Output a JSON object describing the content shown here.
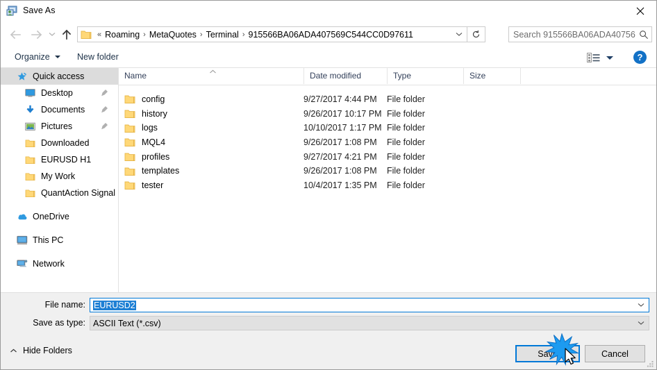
{
  "window": {
    "title": "Save As",
    "close_label": "✕",
    "icon": "save-as-app-icon"
  },
  "nav": {
    "back_icon": "back-arrow-icon",
    "forward_icon": "forward-arrow-icon",
    "recent_icon": "chevron-down-icon",
    "up_icon": "up-arrow-icon"
  },
  "address": {
    "folder_icon": "folder-icon",
    "overflow_marker": "«",
    "crumbs": [
      "Roaming",
      "MetaQuotes",
      "Terminal",
      "915566BA06ADA407569C544CC0D97611"
    ],
    "separator": "›",
    "dropdown_icon": "chevron-down-icon",
    "refresh_icon": "refresh-icon"
  },
  "search": {
    "placeholder": "Search 915566BA06ADA40756...",
    "icon": "search-icon"
  },
  "toolbar": {
    "organize_label": "Organize",
    "new_folder_label": "New folder",
    "view_icon": "view-layout-icon",
    "view_caret_icon": "chevron-down-icon",
    "help_label": "?"
  },
  "sidebar": {
    "items": [
      {
        "label": "Quick access",
        "icon": "star-pin-icon",
        "level": 1,
        "selected": true,
        "pinned": false
      },
      {
        "label": "Desktop",
        "icon": "desktop-icon",
        "level": 2,
        "selected": false,
        "pinned": true
      },
      {
        "label": "Documents",
        "icon": "download-arrow-icon",
        "level": 2,
        "selected": false,
        "pinned": true
      },
      {
        "label": "Pictures",
        "icon": "pictures-icon",
        "level": 2,
        "selected": false,
        "pinned": true
      },
      {
        "label": "Downloaded",
        "icon": "folder-icon",
        "level": 2,
        "selected": false,
        "pinned": false
      },
      {
        "label": "EURUSD H1",
        "icon": "folder-icon",
        "level": 2,
        "selected": false,
        "pinned": false
      },
      {
        "label": "My Work",
        "icon": "folder-icon",
        "level": 2,
        "selected": false,
        "pinned": false
      },
      {
        "label": "QuantAction Signal",
        "icon": "folder-icon",
        "level": 2,
        "selected": false,
        "pinned": false
      },
      {
        "label": "OneDrive",
        "icon": "cloud-icon",
        "level": 1,
        "selected": false,
        "pinned": false,
        "gap_before": true
      },
      {
        "label": "This PC",
        "icon": "this-pc-icon",
        "level": 1,
        "selected": false,
        "pinned": false,
        "gap_before": true
      },
      {
        "label": "Network",
        "icon": "network-icon",
        "level": 1,
        "selected": false,
        "pinned": false,
        "gap_before": true
      }
    ]
  },
  "filelist": {
    "columns": [
      "Name",
      "Date modified",
      "Type",
      "Size"
    ],
    "sort_column": "Name",
    "sort_direction": "ascending",
    "rows": [
      {
        "name": "config",
        "date": "9/27/2017 4:44 PM",
        "type": "File folder",
        "size": ""
      },
      {
        "name": "history",
        "date": "9/26/2017 10:17 PM",
        "type": "File folder",
        "size": ""
      },
      {
        "name": "logs",
        "date": "10/10/2017 1:17 PM",
        "type": "File folder",
        "size": ""
      },
      {
        "name": "MQL4",
        "date": "9/26/2017 1:08 PM",
        "type": "File folder",
        "size": ""
      },
      {
        "name": "profiles",
        "date": "9/27/2017 4:21 PM",
        "type": "File folder",
        "size": ""
      },
      {
        "name": "templates",
        "date": "9/26/2017 1:08 PM",
        "type": "File folder",
        "size": ""
      },
      {
        "name": "tester",
        "date": "10/4/2017 1:35 PM",
        "type": "File folder",
        "size": ""
      }
    ]
  },
  "form": {
    "filename_label": "File name:",
    "filename_value": "EURUSD2",
    "filename_selected": true,
    "savetype_label": "Save as type:",
    "savetype_value": "ASCII Text (*.csv)",
    "dropdown_icon": "chevron-down-icon"
  },
  "footer": {
    "hide_folders_label": "Hide Folders",
    "hide_folders_icon": "chevron-up-icon",
    "save_label": "Save",
    "cancel_label": "Cancel",
    "resize_grip_icon": "resize-grip-icon"
  },
  "colors": {
    "accent": "#0078d7",
    "selection": "#1d7fd4",
    "dialog_bg": "#f0f0f0",
    "list_bg": "#ffffff",
    "folder_yellow": "#ffd878",
    "help_blue": "#1271c6"
  },
  "overlay": {
    "click_effect_icon": "click-burst-icon",
    "cursor_icon": "mouse-pointer-icon"
  }
}
